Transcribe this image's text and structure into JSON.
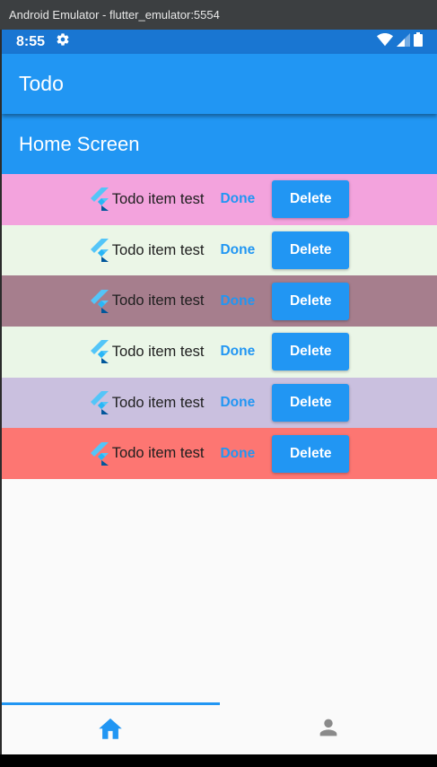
{
  "window": {
    "title": "Android Emulator - flutter_emulator:5554"
  },
  "status_bar": {
    "time": "8:55",
    "settings_icon": "gear-icon",
    "wifi_icon": "wifi-icon",
    "signal_icon": "signal-icon",
    "battery_icon": "battery-icon"
  },
  "app_bar": {
    "title": "Todo"
  },
  "header": {
    "title": "Home Screen"
  },
  "todos": [
    {
      "text": "Todo item test",
      "done_label": "Done",
      "delete_label": "Delete",
      "bg": "#f3a3dd",
      "done_color": "#2196f3"
    },
    {
      "text": "Todo item test",
      "done_label": "Done",
      "delete_label": "Delete",
      "bg": "#ebf6e7",
      "done_color": "#2196f3"
    },
    {
      "text": "Todo item test",
      "done_label": "Done",
      "delete_label": "Delete",
      "bg": "#a67e8d",
      "done_color": "#2196f3"
    },
    {
      "text": "Todo item test",
      "done_label": "Done",
      "delete_label": "Delete",
      "bg": "#eaf6e7",
      "done_color": "#2196f3"
    },
    {
      "text": "Todo item test",
      "done_label": "Done",
      "delete_label": "Delete",
      "bg": "#cac0df",
      "done_color": "#2196f3"
    },
    {
      "text": "Todo item test",
      "done_label": "Done",
      "delete_label": "Delete",
      "bg": "#fd7672",
      "done_color": "#2196f3"
    }
  ],
  "bottom_nav": {
    "items": [
      {
        "icon": "home-icon",
        "active": true
      },
      {
        "icon": "person-icon",
        "active": false
      }
    ],
    "active_color": "#2196f3",
    "inactive_color": "#8a8a8a"
  },
  "colors": {
    "primary": "#2196f3",
    "status_bar": "#1976d2"
  }
}
